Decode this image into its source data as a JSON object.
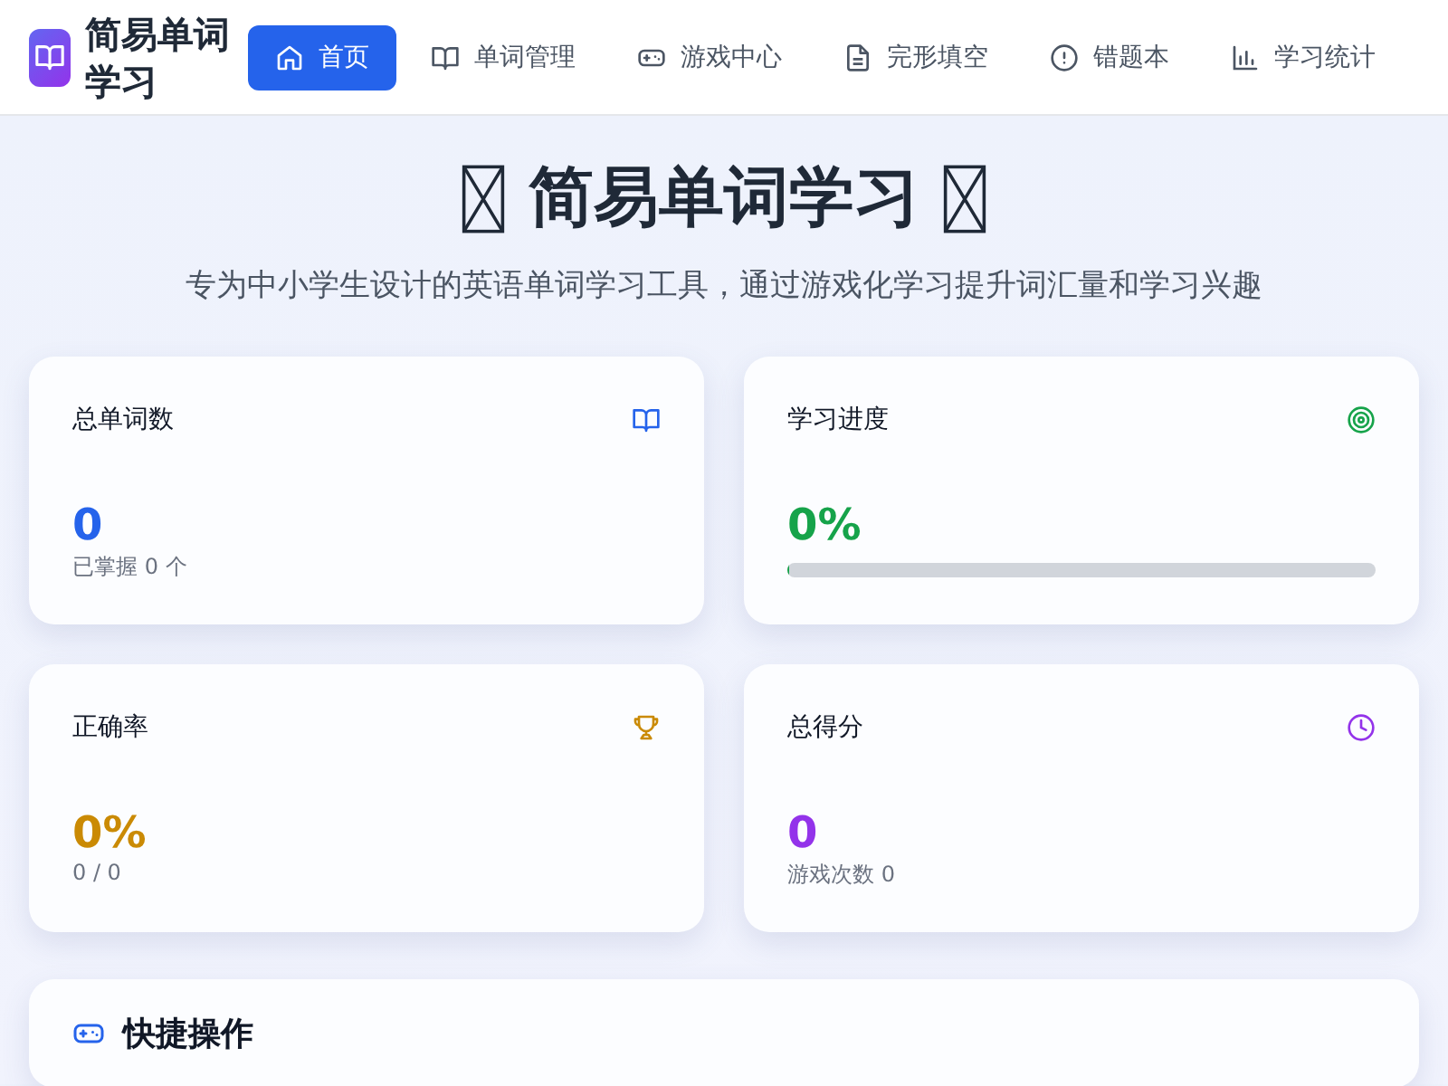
{
  "app": {
    "title": "简易单词学习"
  },
  "nav": [
    {
      "label": "首页",
      "selected": true
    },
    {
      "label": "单词管理",
      "selected": false
    },
    {
      "label": "游戏中心",
      "selected": false
    },
    {
      "label": "完形填空",
      "selected": false
    },
    {
      "label": "错题本",
      "selected": false
    },
    {
      "label": "学习统计",
      "selected": false
    }
  ],
  "hero": {
    "title": "简易单词学习",
    "subtitle": "专为中小学生设计的英语单词学习工具，通过游戏化学习提升词汇量和学习兴趣"
  },
  "stats": [
    {
      "title": "总单词数",
      "color": "#2563eb",
      "value": "0",
      "kind": "text",
      "note": "已掌握 0 个"
    },
    {
      "title": "学习进度",
      "color": "#16a34a",
      "value": "0%",
      "kind": "progress",
      "level": 0
    },
    {
      "title": "正确率",
      "color": "#ca8a04",
      "value": "0%",
      "kind": "text",
      "note": "0 / 0"
    },
    {
      "title": "总得分",
      "color": "#9333ea",
      "value": "0",
      "kind": "text",
      "note": "游戏次数 0"
    }
  ],
  "quick_actions": {
    "title": "快捷操作"
  }
}
